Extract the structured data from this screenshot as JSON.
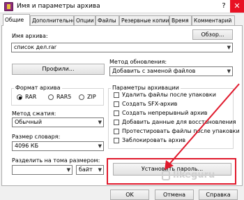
{
  "window": {
    "title": "Имя и параметры архива",
    "help": "?",
    "close": "✕"
  },
  "tabs": [
    "Общие",
    "Дополнительно",
    "Опции",
    "Файлы",
    "Резервные копии",
    "Время",
    "Комментарий"
  ],
  "archive": {
    "name_label": "Имя архива:",
    "name_value": "список дел.rar",
    "browse_button": "Обзор..."
  },
  "update": {
    "label": "Метод обновления:",
    "value": "Добавить с заменой файлов"
  },
  "profiles_button": "Профили...",
  "format": {
    "label": "Формат архива",
    "options": [
      "RAR",
      "RAR5",
      "ZIP"
    ],
    "selected": "RAR"
  },
  "compression": {
    "label": "Метод сжатия:",
    "value": "Обычный"
  },
  "dictionary": {
    "label": "Размер словаря:",
    "value": "4096 КБ"
  },
  "split": {
    "label": "Разделить на тома размером:",
    "unit": "байт"
  },
  "options": {
    "label": "Параметры архивации",
    "items": [
      "Удалить файлы после упаковки",
      "Создать SFX-архив",
      "Создать непрерывный архив",
      "Добавить данные для восстановления",
      "Протестировать файлы после упаковки",
      "Заблокировать архив"
    ]
  },
  "password_button": "Установить пароль...",
  "footer": {
    "ok": "OK",
    "cancel": "Отмена",
    "help": "Справка"
  },
  "watermark": "likeguru",
  "colors": {
    "highlight": "#e0192c",
    "close": "#e81123"
  }
}
